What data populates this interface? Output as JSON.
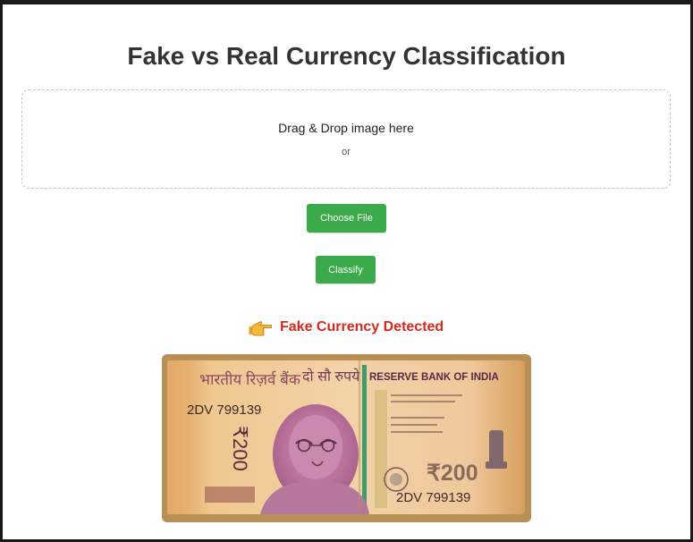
{
  "page": {
    "title": "Fake vs Real Currency Classification"
  },
  "dropzone": {
    "main_text": "Drag & Drop image here",
    "or_text": "or"
  },
  "buttons": {
    "choose_file": "Choose File",
    "classify": "Classify"
  },
  "result": {
    "icon": "pointing-hand-icon",
    "text": "Fake Currency Detected",
    "color": "#d42a1e"
  },
  "banknote": {
    "hindi_bank_name": "भारतीय रिज़र्व बैंक",
    "hindi_denomination": "दो सौ रुपये",
    "english_bank_name": "RESERVE BANK OF INDIA",
    "serial_number": "2DV 799139",
    "denomination_symbol": "₹200",
    "vertical_denomination": "₹200"
  },
  "colors": {
    "accent_button": "#3aaa4a",
    "title_text": "#333333"
  }
}
